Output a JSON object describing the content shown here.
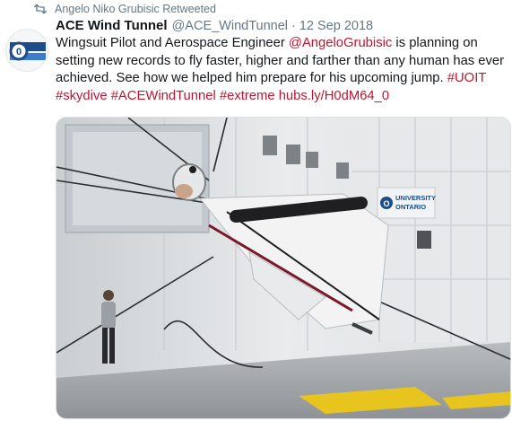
{
  "retweet": {
    "text": "Angelo Niko Grubisic Retweeted",
    "icon": "retweet-icon"
  },
  "tweet": {
    "display_name": "ACE Wind Tunnel",
    "handle": "@ACE_WindTunnel",
    "separator": "·",
    "date": "12 Sep 2018",
    "text_parts": {
      "p1": "Wingsuit Pilot and Aerospace Engineer ",
      "mention": "@AngeloGrubisic",
      "p2": " is planning on setting new records to fly faster, higher and farther than any human has ever achieved. See how we helped him prepare for his upcoming jump. ",
      "hashtag1": "#UOIT",
      "hashtag2": "#skydive",
      "hashtag3": "#ACEWindTunnel",
      "hashtag4": "#extreme",
      "url": "hubs.ly/H0dM64_0"
    }
  },
  "avatar": {
    "icon": "ace-logo"
  },
  "media": {
    "alt": "wingsuit pilot suspended in wind tunnel",
    "sign_line1": "UNIVERSITY",
    "sign_line2": "ONTARIO",
    "sign_letter": "O"
  },
  "colors": {
    "link": "#c0152f",
    "muted": "#657786",
    "text": "#14171a"
  }
}
